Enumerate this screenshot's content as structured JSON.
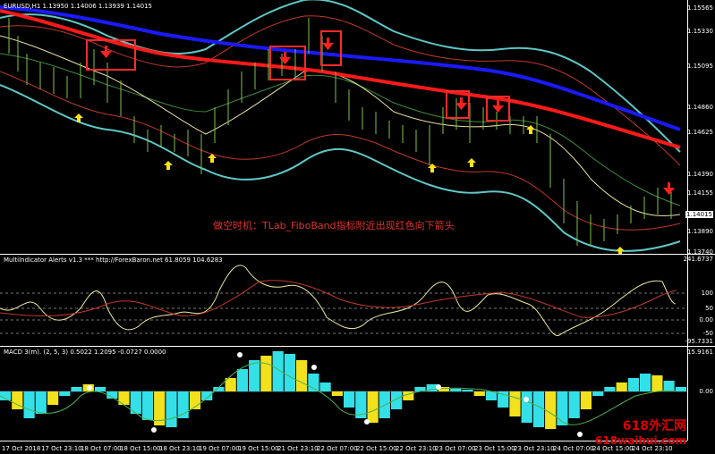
{
  "main": {
    "header": "EURUSD,H1  1.13950 1.14006 1.13939 1.14015",
    "price_labels": [
      "1.15565",
      "1.15330",
      "1.15095",
      "1.14860",
      "1.14625",
      "1.14390",
      "1.14155",
      "1.13890",
      "1.13740"
    ],
    "current_price": "1.14015",
    "note": "做空时机：TLab_FiboBand指标附近出现红色向下箭头"
  },
  "ind1": {
    "header": "MultiIndicator Alerts v1.3 *** http://ForexBaron.net 61.8059 104.6283",
    "levels": [
      "241.6737",
      "100",
      "50",
      "0.00",
      "-50",
      "-95.7331"
    ]
  },
  "ind2": {
    "header": "MACD 3(m). (2, 5, 3) 0.5022 1.2095 -0.0727 0.0000",
    "levels": [
      "15.9161",
      "0.00"
    ]
  },
  "time_axis": [
    "17 Oct 2018",
    "17 Oct 23:10",
    "18 Oct 07:00",
    "18 Oct 15:00",
    "18 Oct 23:10",
    "19 Oct 07:00",
    "19 Oct 15:00",
    "21 Oct 23:10",
    "22 Oct 07:00",
    "22 Oct 15:00",
    "22 Oct 23:10",
    "23 Oct 07:00",
    "23 Oct 15:00",
    "23 Oct 23:10",
    "24 Oct 07:00",
    "24 Oct 15:00",
    "24 Oct 23:10"
  ],
  "watermark": {
    "line1": "618外汇网",
    "line2": "618waihui.com"
  },
  "colors": {
    "bg": "#000000",
    "ma_slow": "#1a1aff",
    "ma_fast": "#ff1a1a",
    "band_outer": "#5fc7c7",
    "candle": "#7fc24a",
    "up_arrow": "#ffe21a",
    "down_arrow": "#ff2020",
    "hist_cyan": "#33e0e8",
    "hist_yellow": "#f2e11c"
  }
}
